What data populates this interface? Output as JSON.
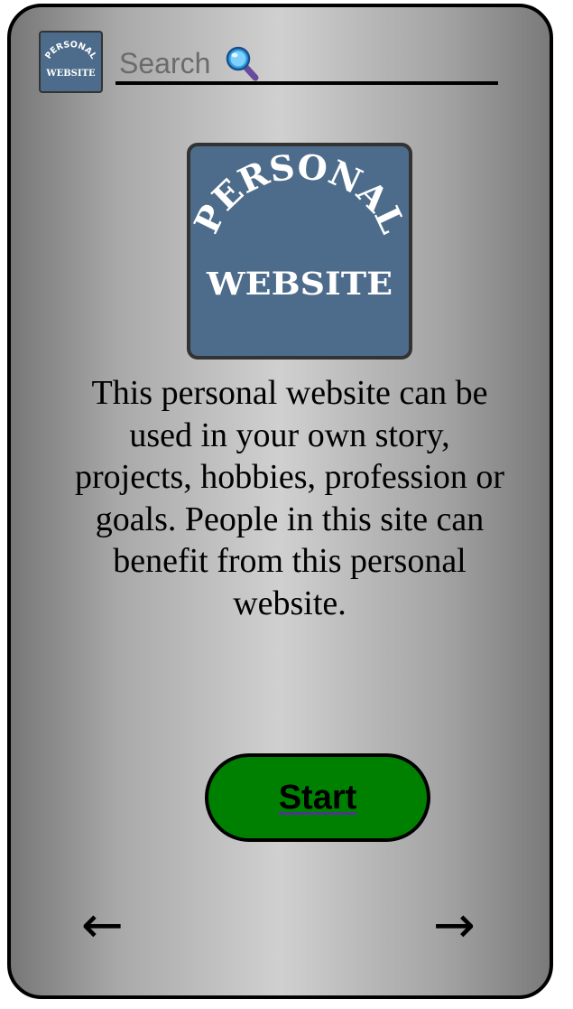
{
  "header": {
    "logo": {
      "line1": "PERSONAL",
      "line2": "WEBSITE"
    },
    "search": {
      "placeholder": "Search",
      "icon": "search-icon"
    }
  },
  "main": {
    "logo": {
      "line1": "PERSONAL",
      "line2": "WEBSITE"
    },
    "description": "This personal website can be used in your own story, projects, hobbies, profession or goals. People in this site can benefit from this personal website.",
    "start_label": "Start"
  },
  "nav": {
    "back": "←",
    "forward": "→"
  },
  "colors": {
    "logo_bg": "#4d6c8b",
    "start_button": "#008000",
    "frame_border": "#000000"
  }
}
